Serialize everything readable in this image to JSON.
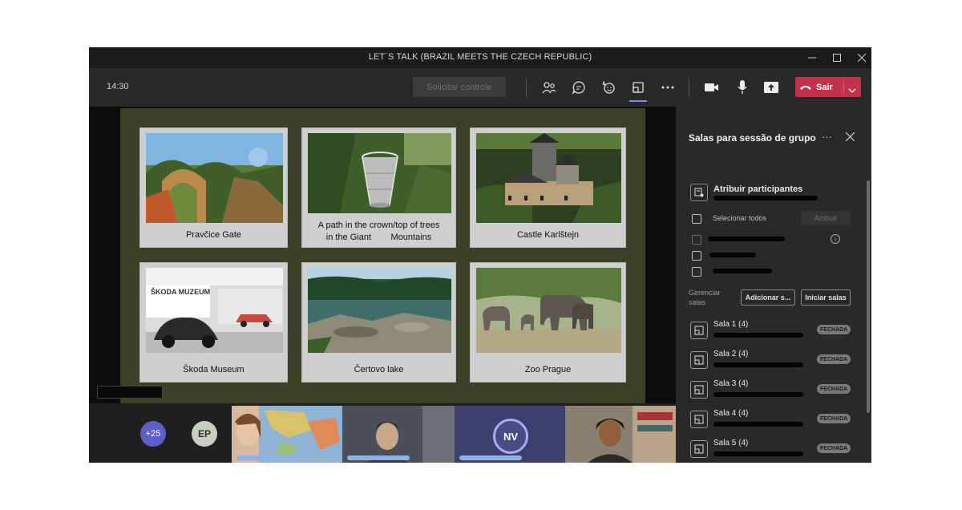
{
  "window": {
    "title": "LET´S TALK (BRAZIL MEETS THE CZECH REPUBLIC)",
    "controls": [
      "minimize-icon",
      "maximize-icon",
      "close-icon"
    ]
  },
  "toolbar": {
    "time": "14:30",
    "request_control": "Solicitar controle",
    "icons": [
      "people-icon",
      "chat-icon",
      "reactions-icon",
      "breakout-rooms-icon",
      "more-icon",
      "camera-icon",
      "mic-icon",
      "share-icon"
    ],
    "active_icon": "breakout-rooms-icon",
    "leave_label": "Sair",
    "leave_color": "#c4314b"
  },
  "slide": {
    "background": "#3b4127",
    "cards": [
      {
        "caption": "Pravčice Gate"
      },
      {
        "caption_line1": "A path in the crown/top of trees",
        "caption_line2": "in the Giant        Mountains"
      },
      {
        "caption": "Castle Karlštejn"
      },
      {
        "caption": "Škoda Museum",
        "image_text": "ŠKODA MUZEUM"
      },
      {
        "caption": "Čertovo lake"
      },
      {
        "caption": "Zoo Prague"
      }
    ]
  },
  "participants": {
    "more_count": "+25",
    "ep_initials": "EP",
    "nv_initials": "NV"
  },
  "panel": {
    "title": "Salas para sessão de grupo",
    "assign_title": "Atribuir participantes",
    "select_all": "Selecionar todos",
    "assign_button": "Atribuir",
    "manage_label": "Gerenciar salas",
    "add_button": "Adicionar s...",
    "start_button": "Iniciar salas",
    "rooms": [
      {
        "name": "Sala 1 (4)",
        "status": "FECHADA"
      },
      {
        "name": "Sala 2 (4)",
        "status": "FECHADA"
      },
      {
        "name": "Sala 3 (4)",
        "status": "FECHADA"
      },
      {
        "name": "Sala 4 (4)",
        "status": "FECHADA"
      },
      {
        "name": "Sala 5 (4)",
        "status": "FECHADA"
      }
    ]
  }
}
